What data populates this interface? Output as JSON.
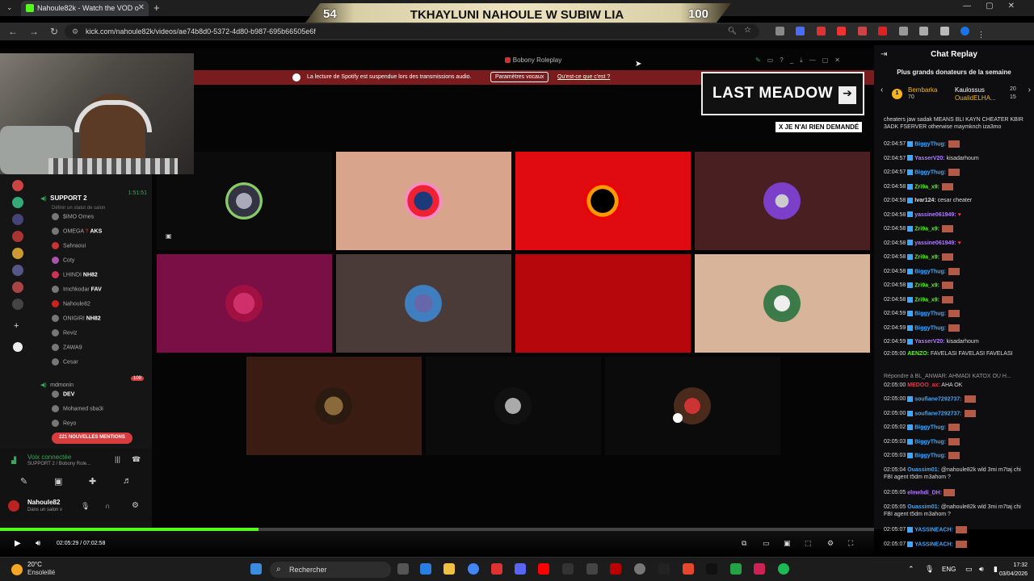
{
  "browser": {
    "tab_title": "Nahoule82k - Watch the VOD o",
    "url": "kick.com/nahoule82k/videos/ae74b8d0-5372-4d80-b987-695b66505e6f"
  },
  "overlay": {
    "left_number": "54",
    "title": "TKHAYLUNI NAHOULE W SUBIW LIA",
    "right_number": "100"
  },
  "discord": {
    "window_title": "Bobony Roleplay",
    "spotify_notice": "La lecture de Spotify est suspendue lors des transmissions audio.",
    "spotify_button": "Paramètres vocaux",
    "spotify_link": "Qu'est-ce que c'est ?",
    "channel_name": "SUPPORT 2",
    "channel_timer": "1:51:51",
    "channel_status": "Définir un statut de salon",
    "members_top": [
      "$IMO Ornes",
      "OMEGA",
      "Sahraoui",
      "Coty",
      "LHINDI",
      "Imchkodar",
      "Nahoule82",
      "ONIGIRI",
      "Reviz",
      "ZAWA9",
      "Cesar"
    ],
    "tag_aks": "AKS",
    "tag_nh82": "NH82",
    "tag_fav": "FAV",
    "tag_dev": "DEV",
    "group2_name": "mdmonin",
    "group2_count": "109",
    "members_bottom": [
      "DEV",
      "Mohamed sba3i",
      "Reyo"
    ],
    "mentions": "221 NOUVELLES MENTIONS",
    "voice_status": "Voix connectée",
    "voice_channel": "SUPPORT 2 / Bobony Role...",
    "user_name": "Nahoule82",
    "user_status": "Dans un salon v"
  },
  "stream_overlay": {
    "game_title": "LAST MEADOW",
    "arrow": "➔",
    "notice": "X JE N'AI RIEN DEMANDÉ"
  },
  "chat": {
    "title": "Chat Replay",
    "donors_heading": "Plus grands donateurs de la semaine",
    "donors": [
      {
        "rank": "1",
        "name": "Bembarka",
        "amount": "70"
      },
      {
        "name": "Kaulossus",
        "amount": "20"
      },
      {
        "name": "OualidELHA...",
        "amount": "15"
      }
    ],
    "top_text": "cheaters jaw sadak MEANS BLI KAYN CHEATER KBIR 3ADK FSERVER otherwise maymknch iza3mo",
    "messages": [
      {
        "time": "02:04:57",
        "user": "BiggyThug:",
        "text": "",
        "color": "#3fa7ff"
      },
      {
        "time": "02:04:57",
        "user": "YasserV20:",
        "text": "kisadarhoum",
        "color": "#b37cff"
      },
      {
        "time": "02:04:57",
        "user": "BiggyThug:",
        "text": "",
        "color": "#3fa7ff"
      },
      {
        "time": "02:04:58",
        "user": "Zri9a_x9:",
        "text": "",
        "color": "#53fc18"
      },
      {
        "time": "02:04:58",
        "user": "Ivar124:",
        "text": "cesar cheater",
        "color": "#dddddd"
      },
      {
        "time": "02:04:58",
        "user": "yassine061949:",
        "text": "",
        "color": "#b37cff"
      },
      {
        "time": "02:04:58",
        "user": "Zri9a_x9:",
        "text": "",
        "color": "#53fc18"
      },
      {
        "time": "02:04:58",
        "user": "yassine061949:",
        "text": "",
        "color": "#b37cff"
      },
      {
        "time": "02:04:58",
        "user": "Zri9a_x9:",
        "text": "",
        "color": "#53fc18"
      },
      {
        "time": "02:04:58",
        "user": "BiggyThug:",
        "text": "",
        "color": "#3fa7ff"
      },
      {
        "time": "02:04:58",
        "user": "Zri9a_x9:",
        "text": "",
        "color": "#53fc18"
      },
      {
        "time": "02:04:58",
        "user": "Zri9a_x9:",
        "text": "",
        "color": "#53fc18"
      },
      {
        "time": "02:04:59",
        "user": "BiggyThug:",
        "text": "",
        "color": "#3fa7ff"
      },
      {
        "time": "02:04:59",
        "user": "BiggyThug:",
        "text": "",
        "color": "#3fa7ff"
      },
      {
        "time": "02:04:59",
        "user": "YasserV20:",
        "text": "kisadarhoum",
        "color": "#b37cff"
      }
    ],
    "msg_aenzo": {
      "time": "02:05:00",
      "user": "AENZO:",
      "text": "FAVELASI FAVELASI FAVELASI"
    },
    "reply_to": "Répondre à BL_ANWAR: AHMADI KATOX OU H...",
    "msg_reply": {
      "time": "02:05:00",
      "user": "MEDOO_ax:",
      "text": "AHA OK"
    },
    "messages2": [
      {
        "time": "02:05:00",
        "user": "soufiane7292737:",
        "color": "#3fa7ff"
      },
      {
        "time": "02:05:00",
        "user": "soufiane7292737:",
        "color": "#3fa7ff"
      },
      {
        "time": "02:05:02",
        "user": "BiggyThug:",
        "color": "#3fa7ff"
      },
      {
        "time": "02:05:03",
        "user": "BiggyThug:",
        "color": "#3fa7ff"
      },
      {
        "time": "02:05:03",
        "user": "BiggyThug:",
        "color": "#3fa7ff"
      }
    ],
    "msg_q1": {
      "time": "02:05:04",
      "user": "Ouassim01:",
      "text": "@nahoule82k wld 3mi m7taj chi FBI agent t5dm m3ahom ?"
    },
    "msg_q2": {
      "time": "02:05:05",
      "user": "elmehdi_DH:",
      "text": ""
    },
    "msg_q3": {
      "time": "02:05:05",
      "user": "Ouassim01:",
      "text": "@nahoule82k wld 3mi m7taj chi FBI agent t5dm m3ahom ?"
    },
    "messages3": [
      {
        "time": "02:05:07",
        "user": "YASSINEACH:"
      },
      {
        "time": "02:05:07",
        "user": "YASSINEACH:"
      }
    ]
  },
  "player": {
    "time": "02:05:29 / 07:02:58",
    "progress": 0.296
  },
  "taskbar": {
    "temperature": "20°C",
    "weather": "Ensoleillé",
    "search": "Rechercher",
    "lang": "ENG",
    "time": "17:32",
    "date": "03/04/2026"
  },
  "colors": {
    "kick_green": "#53fc18",
    "tile_peach": "#d8a48c",
    "tile_red": "#e00b10",
    "tile_maroon": "#4a1f22",
    "tile_magenta": "#7a0f45",
    "tile_gray": "#4a3b39",
    "tile_crimson": "#b5070c",
    "tile_tan": "#d8b49a",
    "tile_brown": "#3b1c12"
  }
}
